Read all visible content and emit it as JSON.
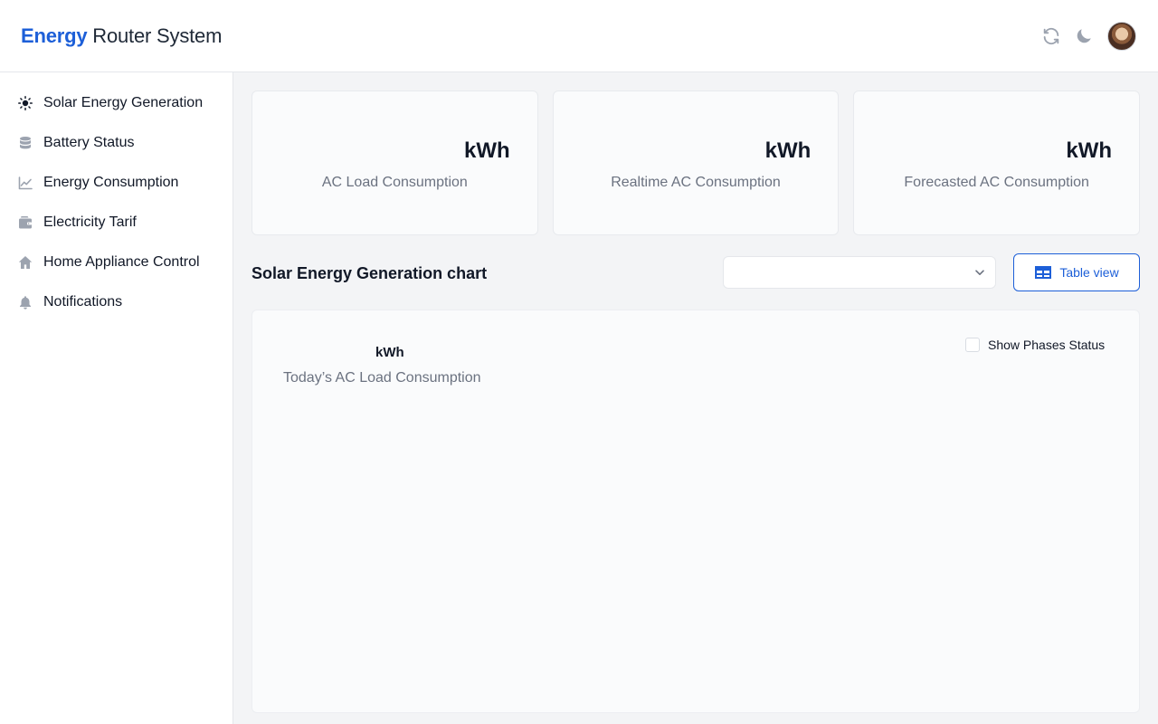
{
  "header": {
    "brand_strong": "Energy",
    "brand_rest": " Router System",
    "icons": [
      "refresh-icon",
      "moon-icon",
      "avatar"
    ]
  },
  "sidebar": {
    "items": [
      {
        "label": "Solar Energy Generation",
        "icon": "sun-icon"
      },
      {
        "label": "Battery Status",
        "icon": "database-icon"
      },
      {
        "label": "Energy Consumption",
        "icon": "chart-line-icon"
      },
      {
        "label": "Electricity Tarif",
        "icon": "wallet-icon"
      },
      {
        "label": "Home Appliance Control",
        "icon": "home-icon"
      },
      {
        "label": "Notifications",
        "icon": "bell-icon"
      }
    ]
  },
  "cards": [
    {
      "unit": "kWh",
      "label": "AC Load Consumption"
    },
    {
      "unit": "kWh",
      "label": "Realtime AC Consumption"
    },
    {
      "unit": "kWh",
      "label": "Forecasted AC Consumption"
    }
  ],
  "section": {
    "title": "Solar Energy Generation chart",
    "select_value": "",
    "table_button_label": "Table view"
  },
  "chart_panel": {
    "unit": "kWh",
    "label": "Today’s AC Load Consumption",
    "phases_label": "Show Phases Status",
    "phases_checked": false
  },
  "colors": {
    "accent": "#1d5fd8",
    "muted_text": "#6b7280",
    "icon_gray": "#9ca3af"
  }
}
